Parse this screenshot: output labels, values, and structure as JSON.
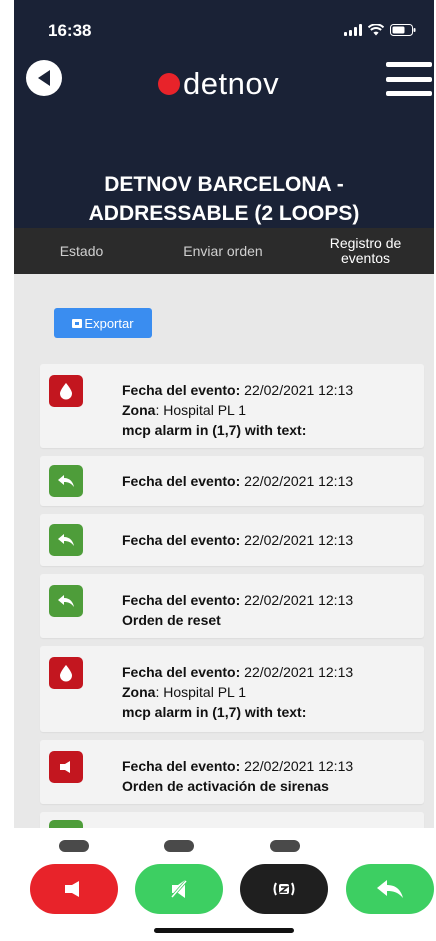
{
  "status_bar": {
    "time": "16:38"
  },
  "header": {
    "logo_text": "detnov",
    "title_line1": "DETNOV BARCELONA -",
    "title_line2": "ADDRESSABLE (2 LOOPS)"
  },
  "tabs": [
    {
      "label": "Estado",
      "active": false
    },
    {
      "label": "Enviar orden",
      "active": false
    },
    {
      "label_line1": "Registro de",
      "label_line2": "eventos",
      "active": true
    }
  ],
  "export_label": "Exportar",
  "events": [
    {
      "type": "alarm",
      "date_label": "Fecha del evento:",
      "date": "22/02/2021 12:13",
      "zone_label": "Zona",
      "zone": ": Hospital PL 1",
      "message": "mcp alarm in (1,7) with text:"
    },
    {
      "type": "reset",
      "date_label": "Fecha del evento:",
      "date": "22/02/2021 12:13"
    },
    {
      "type": "reset",
      "date_label": "Fecha del evento:",
      "date": "22/02/2021 12:13"
    },
    {
      "type": "reset",
      "date_label": "Fecha del evento:",
      "date": "22/02/2021 12:13",
      "message": "Orden de reset"
    },
    {
      "type": "alarm",
      "date_label": "Fecha del evento:",
      "date": "22/02/2021 12:13",
      "zone_label": "Zona",
      "zone": ": Hospital PL 1",
      "message": "mcp alarm in (1,7) with text:"
    },
    {
      "type": "siren",
      "date_label": "Fecha del evento:",
      "date": "22/02/2021 12:13",
      "message": "Orden de activación de sirenas"
    }
  ],
  "colors": {
    "header_bg": "#1a2236",
    "brand_red": "#e8232a",
    "alarm_red": "#c3161f",
    "reset_green": "#4e9d3a",
    "action_green": "#3dcf62",
    "export_blue": "#3a8df0"
  },
  "bottom_actions": [
    {
      "icon": "siren-icon"
    },
    {
      "icon": "silence-icon"
    },
    {
      "icon": "buzzer-mute-icon"
    },
    {
      "icon": "reset-icon"
    }
  ]
}
